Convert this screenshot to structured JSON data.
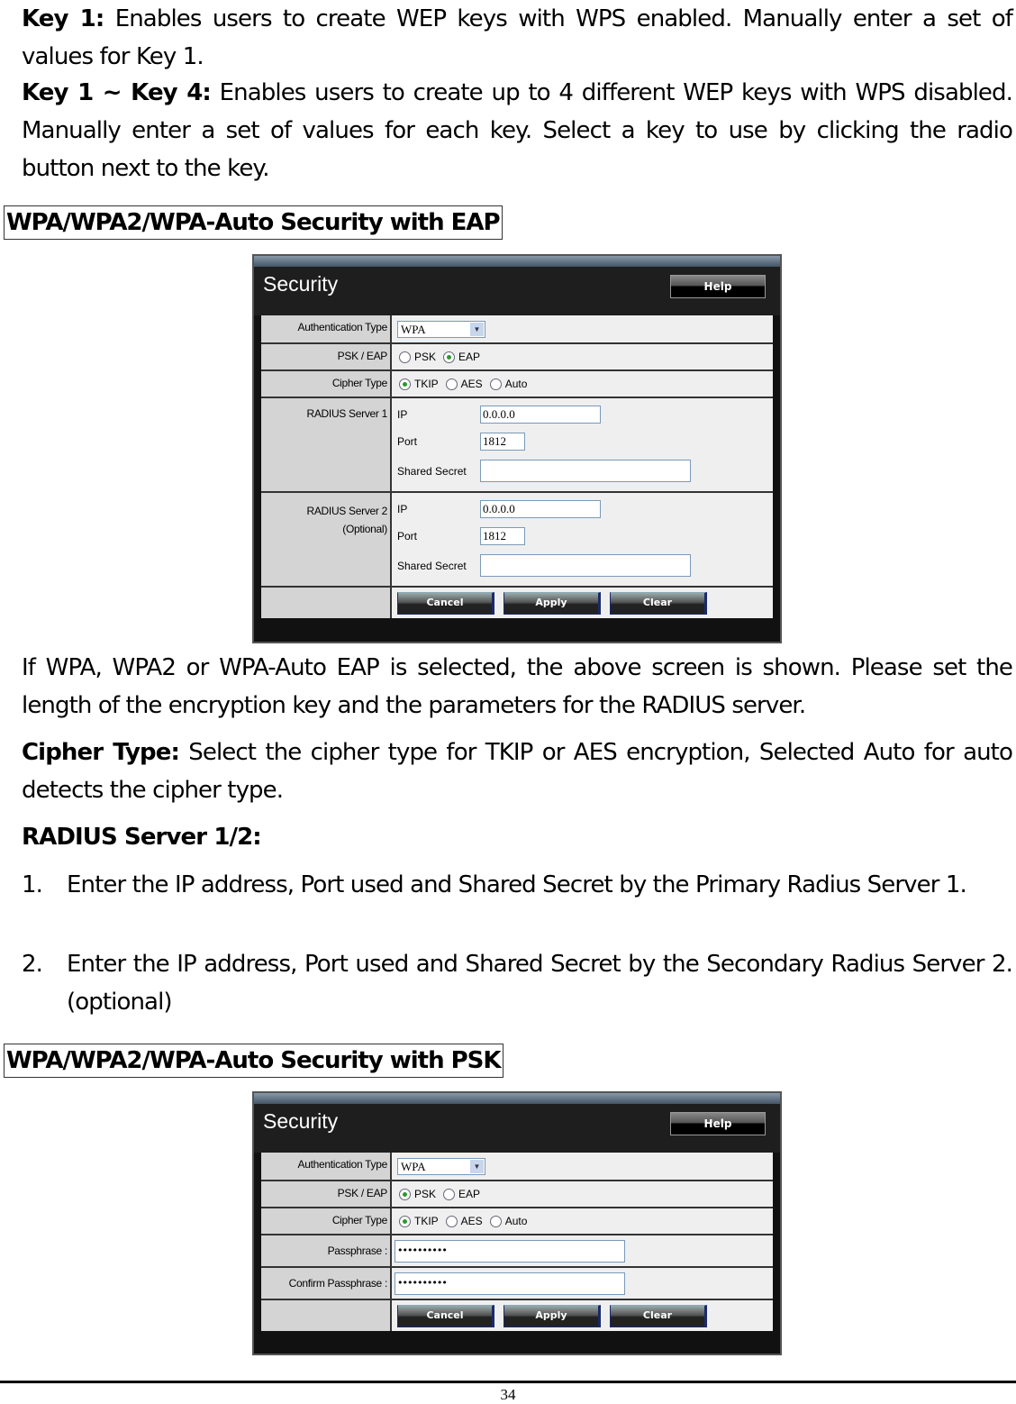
{
  "intro": {
    "key1": {
      "term": "Key 1:",
      "text": " Enables users to create WEP keys with WPS enabled. Manually enter a set of values for Key 1."
    },
    "key1to4": {
      "term": "Key 1 ~ Key 4:",
      "text": " Enables users to create up to 4 different WEP keys with WPS disabled. Manually enter a set of values for each key. Select a key to use by clicking the radio button next to the key."
    }
  },
  "section_eap": {
    "heading": "WPA/WPA2/WPA-Auto Security with EAP",
    "panel": {
      "title": "Security",
      "help_label": "Help",
      "auth_type_label": "Authentication Type",
      "auth_type_value": "WPA",
      "psk_eap_label": "PSK / EAP",
      "psk_eap_options": [
        {
          "label": "PSK",
          "selected": false
        },
        {
          "label": "EAP",
          "selected": true
        }
      ],
      "cipher_label": "Cipher Type",
      "cipher_options": [
        {
          "label": "TKIP",
          "selected": true
        },
        {
          "label": "AES",
          "selected": false
        },
        {
          "label": "Auto",
          "selected": false
        }
      ],
      "radius1": {
        "label": "RADIUS Server 1",
        "sublabel": "",
        "ip_label": "IP",
        "ip": "0.0.0.0",
        "port_label": "Port",
        "port": "1812",
        "secret_label": "Shared Secret",
        "secret": ""
      },
      "radius2": {
        "label": "RADIUS Server 2",
        "sublabel": "(Optional)",
        "ip_label": "IP",
        "ip": "0.0.0.0",
        "port_label": "Port",
        "port": "1812",
        "secret_label": "Shared Secret",
        "secret": ""
      },
      "buttons": {
        "cancel": "Cancel",
        "apply": "Apply",
        "clear": "Clear"
      }
    },
    "desc": "If WPA, WPA2 or WPA-Auto EAP is selected, the above screen is shown.  Please set the length of the encryption key and the parameters for the RADIUS server.",
    "cipher_desc": {
      "term": "Cipher Type:",
      "text": " Select the cipher type for TKIP or AES encryption, Selected Auto for auto detects the cipher type."
    },
    "radius_heading": "RADIUS Server 1/2:",
    "list": [
      {
        "num": "1.",
        "text": "Enter the IP address, Port used and Shared Secret by the Primary Radius Server 1."
      },
      {
        "num": "2.",
        "text": "Enter the IP address, Port used and Shared Secret by the Secondary Radius Server 2. (optional)"
      }
    ]
  },
  "section_psk": {
    "heading": "WPA/WPA2/WPA-Auto Security with PSK",
    "panel": {
      "title": "Security",
      "help_label": "Help",
      "auth_type_label": "Authentication Type",
      "auth_type_value": "WPA",
      "psk_eap_label": "PSK / EAP",
      "psk_eap_options": [
        {
          "label": "PSK",
          "selected": true
        },
        {
          "label": "EAP",
          "selected": false
        }
      ],
      "cipher_label": "Cipher Type",
      "cipher_options": [
        {
          "label": "TKIP",
          "selected": true
        },
        {
          "label": "AES",
          "selected": false
        },
        {
          "label": "Auto",
          "selected": false
        }
      ],
      "passphrase_label": "Passphrase :",
      "passphrase_value": "••••••••••",
      "confirm_label": "Confirm Passphrase :",
      "confirm_value": "••••••••••",
      "buttons": {
        "cancel": "Cancel",
        "apply": "Apply",
        "clear": "Clear"
      }
    }
  },
  "footer": {
    "page_number": "34"
  }
}
